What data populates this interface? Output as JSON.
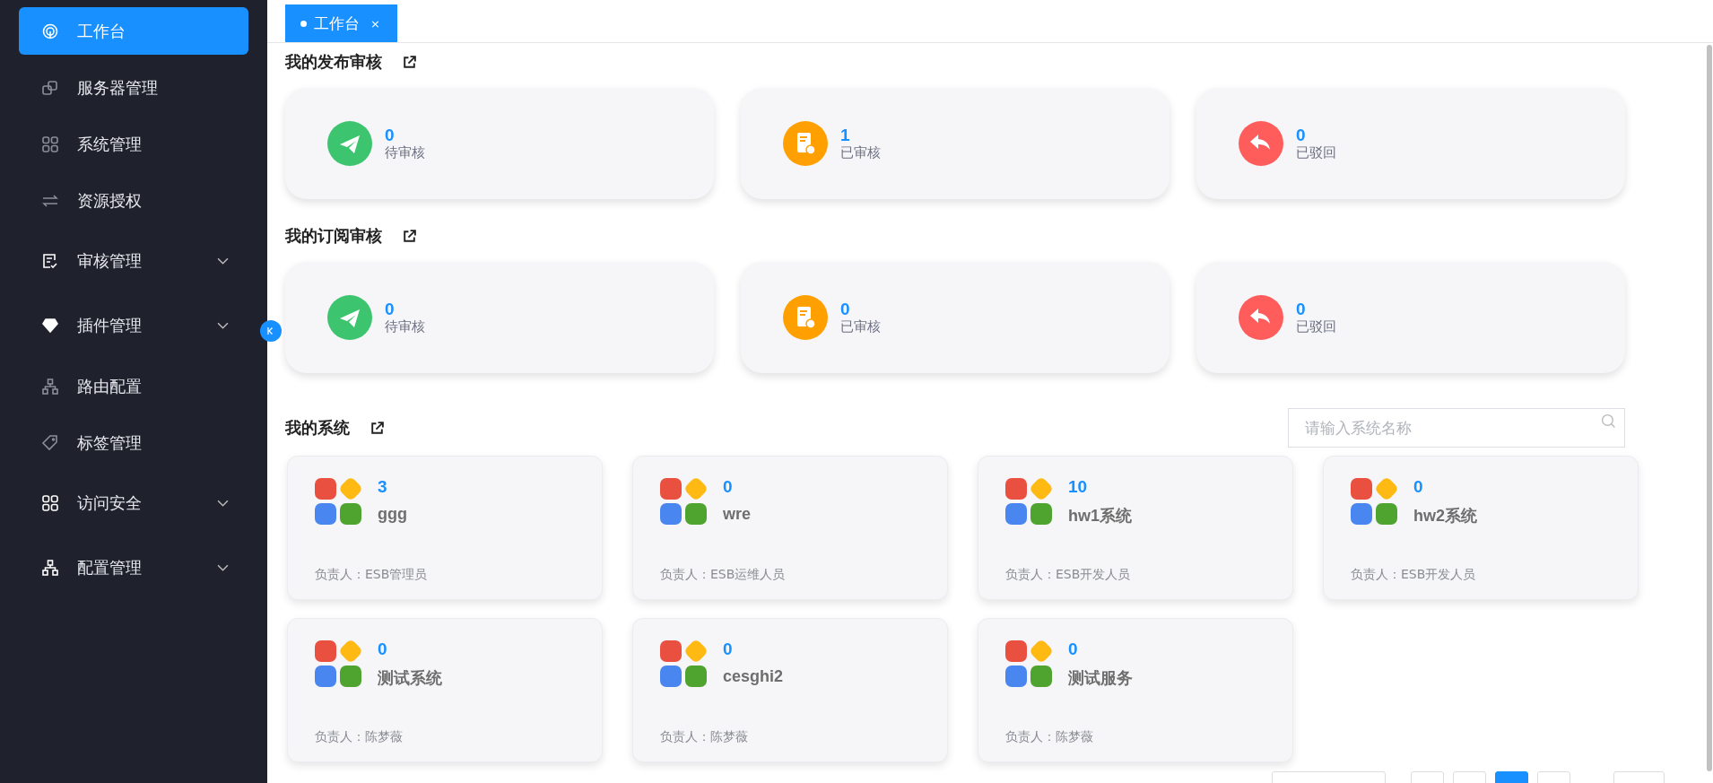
{
  "sidebar": {
    "items": [
      {
        "label": "工作台",
        "selected": true,
        "expandable": false
      },
      {
        "label": "服务器管理",
        "selected": false,
        "expandable": false
      },
      {
        "label": "系统管理",
        "selected": false,
        "expandable": false
      },
      {
        "label": "资源授权",
        "selected": false,
        "expandable": false
      },
      {
        "label": "审核管理",
        "selected": false,
        "expandable": true
      },
      {
        "label": "插件管理",
        "selected": false,
        "expandable": true
      },
      {
        "label": "路由配置",
        "selected": false,
        "expandable": false
      },
      {
        "label": "标签管理",
        "selected": false,
        "expandable": false
      },
      {
        "label": "访问安全",
        "selected": false,
        "expandable": true
      },
      {
        "label": "配置管理",
        "selected": false,
        "expandable": true
      }
    ]
  },
  "tabs": [
    {
      "label": "工作台",
      "selected": true,
      "close": "×"
    }
  ],
  "sections": [
    {
      "title": "我的发布审核",
      "stats": [
        {
          "kind": "pending",
          "count": "0",
          "label": "待审核"
        },
        {
          "kind": "approved",
          "count": "1",
          "label": "已审核"
        },
        {
          "kind": "rejected",
          "count": "0",
          "label": "已驳回"
        }
      ]
    },
    {
      "title": "我的订阅审核",
      "stats": [
        {
          "kind": "pending",
          "count": "0",
          "label": "待审核"
        },
        {
          "kind": "approved",
          "count": "0",
          "label": "已审核"
        },
        {
          "kind": "rejected",
          "count": "0",
          "label": "已驳回"
        }
      ]
    }
  ],
  "systems": {
    "title": "我的系统",
    "search": {
      "placeholder": "请输入系统名称"
    },
    "cards": [
      {
        "count": "3",
        "name": "ggg",
        "owner": "负责人：ESB管理员"
      },
      {
        "count": "0",
        "name": "wre",
        "owner": "负责人：ESB运维人员"
      },
      {
        "count": "10",
        "name": "hw1系统",
        "owner": "负责人：ESB开发人员"
      },
      {
        "count": "0",
        "name": "hw2系统",
        "owner": "负责人：ESB开发人员"
      },
      {
        "count": "0",
        "name": "测试系统",
        "owner": "负责人：陈梦薇"
      },
      {
        "count": "0",
        "name": "cesghi2",
        "owner": "负责人：陈梦薇"
      },
      {
        "count": "0",
        "name": "测试服务",
        "owner": "负责人：陈梦薇"
      }
    ]
  },
  "pagination": {
    "pages": [
      {
        "selected": false
      },
      {
        "selected": true
      },
      {
        "selected": false
      }
    ]
  }
}
